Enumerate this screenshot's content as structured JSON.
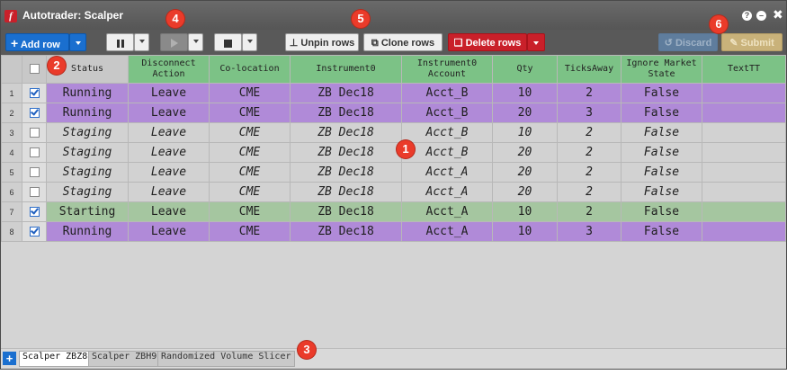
{
  "window": {
    "title": "Autotrader: Scalper",
    "logo_letter": "f"
  },
  "toolbar": {
    "add_row": "Add row",
    "unpin_rows": "Unpin rows",
    "clone_rows": "Clone rows",
    "delete_rows": "Delete rows",
    "discard": "Discard",
    "submit": "Submit"
  },
  "grid": {
    "headers": {
      "status": "Status",
      "disconnect_action": [
        "Disconnect",
        "Action"
      ],
      "colocation": "Co-location",
      "instrument": "Instrument0",
      "account": [
        "Instrument0",
        "Account"
      ],
      "qty": "Qty",
      "ticks_away": "TicksAway",
      "ignore_market_state": [
        "Ignore Market",
        "State"
      ],
      "text_tt": "TextTT"
    },
    "rows": [
      {
        "num": "1",
        "checked": true,
        "status": "Running",
        "action": "Leave",
        "colocation": "CME",
        "instrument": "ZB Dec18",
        "account": "Acct_B",
        "qty": "10",
        "ticks": "2",
        "ignore": "False",
        "text": ""
      },
      {
        "num": "2",
        "checked": true,
        "status": "Running",
        "action": "Leave",
        "colocation": "CME",
        "instrument": "ZB Dec18",
        "account": "Acct_B",
        "qty": "20",
        "ticks": "3",
        "ignore": "False",
        "text": ""
      },
      {
        "num": "3",
        "checked": false,
        "status": "Staging",
        "action": "Leave",
        "colocation": "CME",
        "instrument": "ZB Dec18",
        "account": "Acct_B",
        "qty": "10",
        "ticks": "2",
        "ignore": "False",
        "text": ""
      },
      {
        "num": "4",
        "checked": false,
        "status": "Staging",
        "action": "Leave",
        "colocation": "CME",
        "instrument": "ZB Dec18",
        "account": "Acct_B",
        "qty": "20",
        "ticks": "2",
        "ignore": "False",
        "text": ""
      },
      {
        "num": "5",
        "checked": false,
        "status": "Staging",
        "action": "Leave",
        "colocation": "CME",
        "instrument": "ZB Dec18",
        "account": "Acct_A",
        "qty": "20",
        "ticks": "2",
        "ignore": "False",
        "text": ""
      },
      {
        "num": "6",
        "checked": false,
        "status": "Staging",
        "action": "Leave",
        "colocation": "CME",
        "instrument": "ZB Dec18",
        "account": "Acct_A",
        "qty": "20",
        "ticks": "2",
        "ignore": "False",
        "text": ""
      },
      {
        "num": "7",
        "checked": true,
        "status": "Starting",
        "action": "Leave",
        "colocation": "CME",
        "instrument": "ZB Dec18",
        "account": "Acct_A",
        "qty": "10",
        "ticks": "2",
        "ignore": "False",
        "text": ""
      },
      {
        "num": "8",
        "checked": true,
        "status": "Running",
        "action": "Leave",
        "colocation": "CME",
        "instrument": "ZB Dec18",
        "account": "Acct_A",
        "qty": "10",
        "ticks": "3",
        "ignore": "False",
        "text": ""
      }
    ]
  },
  "tabs": [
    "Scalper ZBZ8",
    "Scalper ZBH9",
    "Randomized Volume Slicer"
  ],
  "callouts": [
    "1",
    "2",
    "3",
    "4",
    "5",
    "6"
  ],
  "colors": {
    "running": "#b08ad8",
    "staging": "#d2d2d2",
    "starting": "#a5c6a0",
    "header": "#7cc286",
    "accent_blue": "#1a6fcf",
    "delete_red": "#c9202a",
    "callout": "#ea3b2a"
  },
  "icons": [
    "app-logo-icon",
    "help-icon",
    "minimize-icon",
    "close-icon",
    "plus-icon",
    "pause-icon",
    "play-icon",
    "stop-icon",
    "pin-icon",
    "clone-icon",
    "trash-icon",
    "undo-icon",
    "pencil-icon",
    "chevron-down-icon"
  ]
}
